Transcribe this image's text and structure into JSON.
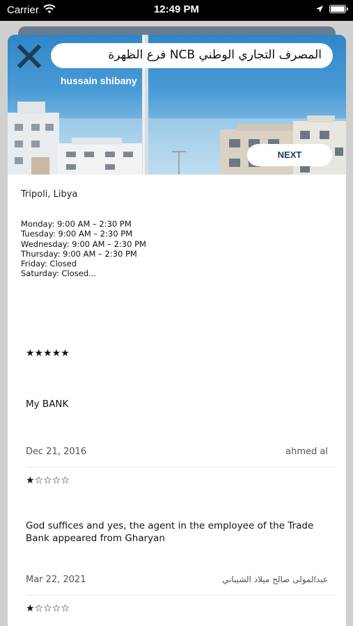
{
  "status_bar": {
    "carrier": "Carrier",
    "time": "12:49 PM"
  },
  "place": {
    "title": "المصرف التجاري الوطني NCB فرع الظهرة",
    "photo_author": "hussain shibany",
    "next_label": "NEXT",
    "location": "Tripoli, Libya",
    "hours": [
      "Monday: 9:00 AM – 2:30 PM",
      "Tuesday: 9:00 AM – 2:30 PM",
      "Wednesday: 9:00 AM – 2:30 PM",
      "Thursday: 9:00 AM – 2:30 PM",
      "Friday: Closed",
      "Saturday: Closed..."
    ]
  },
  "reviews": [
    {
      "rating": 5,
      "stars": "★★★★★",
      "text": "My BANK",
      "date": "Dec 21, 2016",
      "author": "ahmed al"
    },
    {
      "rating": 1,
      "stars": "★☆☆☆☆",
      "text": "God suffices and yes, the agent in the employee of the Trade Bank appeared from Gharyan",
      "date": "Mar 22, 2021",
      "author": "عبدالمولى صالح ميلاد الشيباني"
    },
    {
      "rating": 1,
      "stars": "★☆☆☆☆"
    }
  ],
  "icons": {
    "close": "close-icon",
    "wifi": "wifi-icon",
    "location": "location-arrow-icon",
    "battery": "battery-icon"
  },
  "colors": {
    "close_icon": "#1d3d54",
    "next_text": "#1f3b57",
    "sky_top": "#2f86c8",
    "back_card": "#6b7b8e"
  }
}
